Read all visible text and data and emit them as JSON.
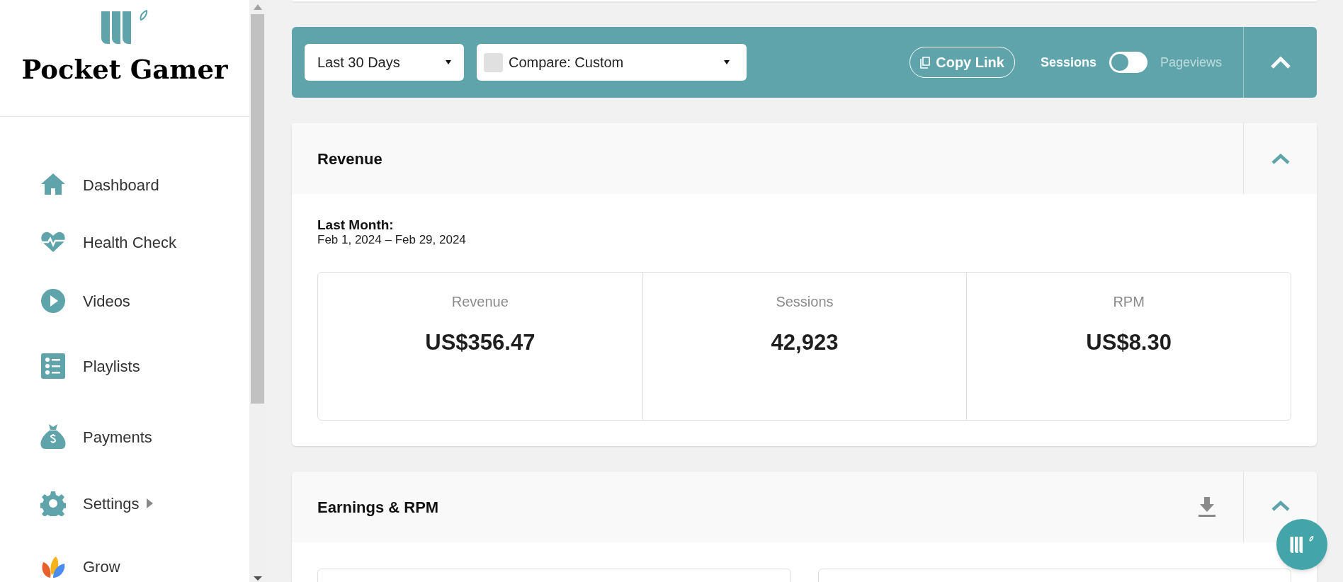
{
  "sidebar": {
    "brand": "Pocket Gamer",
    "items": [
      {
        "label": "Dashboard",
        "kind": "home",
        "submenu": false
      },
      {
        "label": "Health Check",
        "kind": "heart",
        "submenu": false
      },
      {
        "label": "Videos",
        "kind": "play",
        "submenu": false
      },
      {
        "label": "Playlists",
        "kind": "list",
        "submenu": false
      },
      {
        "label": "Payments",
        "kind": "money",
        "submenu": false
      },
      {
        "label": "Settings",
        "kind": "gear",
        "submenu": true
      },
      {
        "label": "Grow",
        "kind": "grow",
        "submenu": false
      }
    ]
  },
  "toolbar": {
    "date_range": "Last 30 Days",
    "compare": "Compare: Custom",
    "copy_link": "Copy Link",
    "toggle": {
      "left_label": "Sessions",
      "right_label": "Pageviews",
      "on": false
    }
  },
  "revenue": {
    "title": "Revenue",
    "period_label": "Last Month:",
    "period": "Feb 1, 2024 – Feb 29, 2024",
    "stats": [
      {
        "label": "Revenue",
        "value": "US$356.47"
      },
      {
        "label": "Sessions",
        "value": "42,923"
      },
      {
        "label": "RPM",
        "value": "US$8.30"
      }
    ]
  },
  "earnings": {
    "title": "Earnings & RPM"
  }
}
